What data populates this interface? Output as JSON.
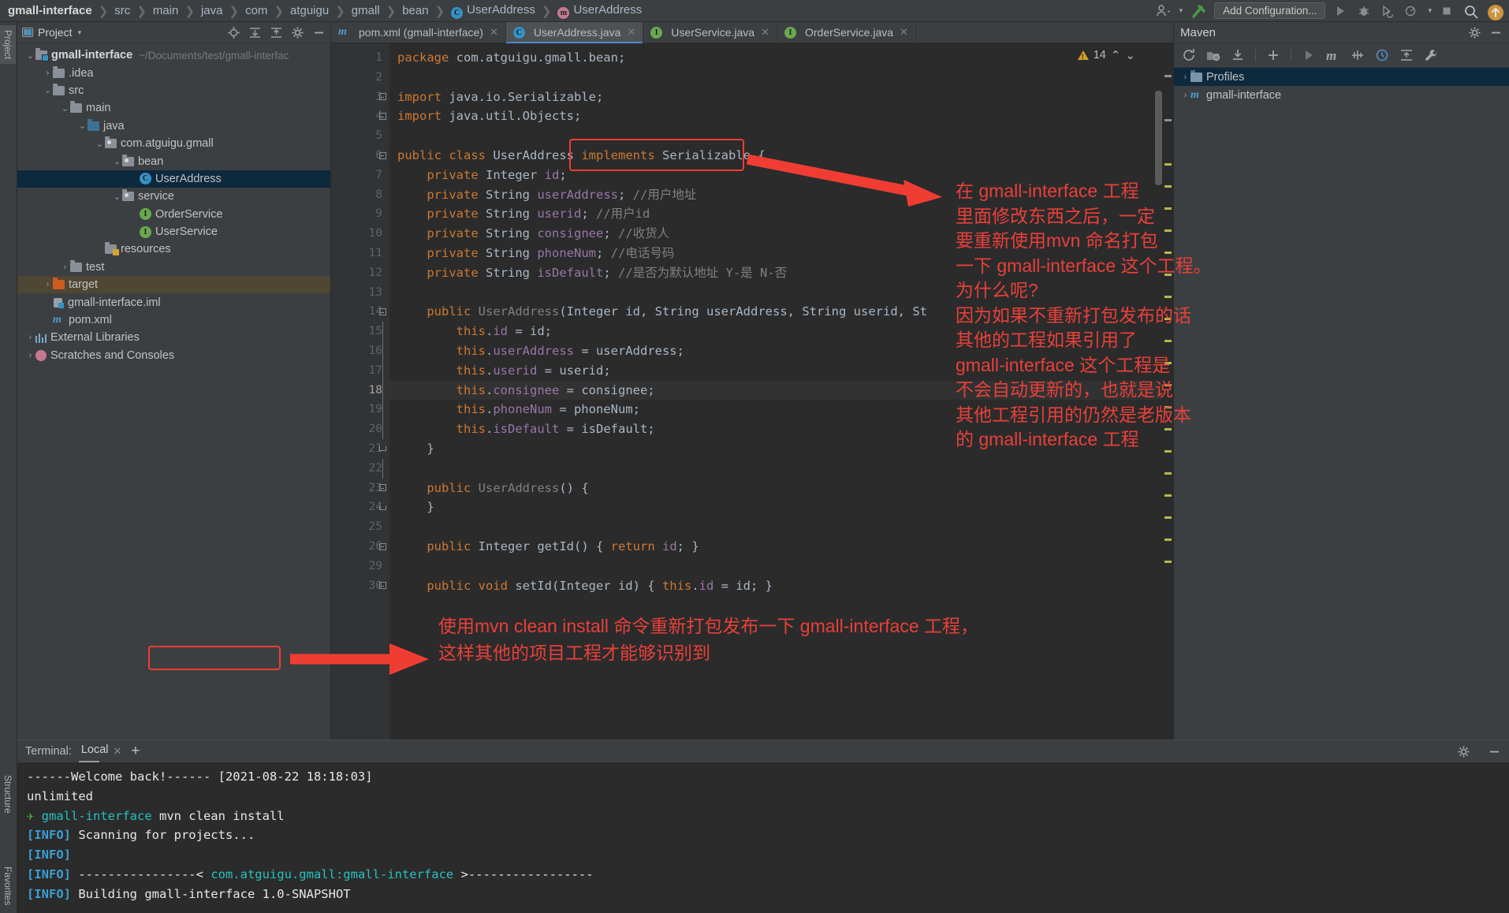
{
  "breadcrumb": [
    {
      "label": "gmall-interface",
      "bold": true,
      "icon": null
    },
    {
      "label": "src",
      "bold": false,
      "icon": null
    },
    {
      "label": "main",
      "bold": false,
      "icon": null
    },
    {
      "label": "java",
      "bold": false,
      "icon": null
    },
    {
      "label": "com",
      "bold": false,
      "icon": null
    },
    {
      "label": "atguigu",
      "bold": false,
      "icon": null
    },
    {
      "label": "gmall",
      "bold": false,
      "icon": null
    },
    {
      "label": "bean",
      "bold": false,
      "icon": null
    },
    {
      "label": "UserAddress",
      "bold": false,
      "icon": "class-icon"
    },
    {
      "label": "UserAddress",
      "bold": false,
      "icon": "method-icon"
    }
  ],
  "toolbar": {
    "add_configuration": "Add Configuration...",
    "icons": [
      "user-settings-icon",
      "build-hammer-icon",
      "run-icon",
      "debug-icon",
      "run-with-coverage-icon",
      "profile-icon",
      "stop-icon",
      "search-icon",
      "update-icon"
    ]
  },
  "left_strip": {
    "project_tab": "Project",
    "structure_tab": "Structure",
    "favorites_tab": "Favorites"
  },
  "project_panel": {
    "title": "Project",
    "toolbar_icons": [
      "locate-icon",
      "expand-all-icon",
      "collapse-all-icon",
      "settings-gear-icon",
      "hide-icon"
    ],
    "tree": [
      {
        "depth": 0,
        "label": "gmall-interface",
        "path": "~/Documents/test/gmall-interfac",
        "icon": "module-folder",
        "arrow": "down",
        "bold": true
      },
      {
        "depth": 1,
        "label": ".idea",
        "icon": "folder",
        "arrow": "right"
      },
      {
        "depth": 1,
        "label": "src",
        "icon": "folder",
        "arrow": "down"
      },
      {
        "depth": 2,
        "label": "main",
        "icon": "folder",
        "arrow": "down"
      },
      {
        "depth": 3,
        "label": "java",
        "icon": "source-folder",
        "arrow": "down"
      },
      {
        "depth": 4,
        "label": "com.atguigu.gmall",
        "icon": "package-folder",
        "arrow": "down"
      },
      {
        "depth": 5,
        "label": "bean",
        "icon": "package-folder",
        "arrow": "down"
      },
      {
        "depth": 6,
        "label": "UserAddress",
        "icon": "class-icon",
        "arrow": "none",
        "selected": true
      },
      {
        "depth": 5,
        "label": "service",
        "icon": "package-folder",
        "arrow": "down"
      },
      {
        "depth": 6,
        "label": "OrderService",
        "icon": "interface-icon",
        "arrow": "none"
      },
      {
        "depth": 6,
        "label": "UserService",
        "icon": "interface-icon",
        "arrow": "none"
      },
      {
        "depth": 4,
        "label": "resources",
        "icon": "resource-folder",
        "arrow": "none"
      },
      {
        "depth": 2,
        "label": "test",
        "icon": "folder",
        "arrow": "right"
      },
      {
        "depth": 1,
        "label": "target",
        "icon": "target-folder",
        "arrow": "right",
        "highlight": true
      },
      {
        "depth": 1,
        "label": "gmall-interface.iml",
        "icon": "iml-icon",
        "arrow": "none"
      },
      {
        "depth": 1,
        "label": "pom.xml",
        "icon": "maven-icon",
        "arrow": "none"
      },
      {
        "depth": 0,
        "label": "External Libraries",
        "icon": "library-icon",
        "arrow": "right"
      },
      {
        "depth": 0,
        "label": "Scratches and Consoles",
        "icon": "scratches-icon",
        "arrow": "right"
      }
    ]
  },
  "editor": {
    "tabs": [
      {
        "label": "pom.xml (gmall-interface)",
        "icon": "maven-icon",
        "active": false,
        "closable": true
      },
      {
        "label": "UserAddress.java",
        "icon": "class-icon",
        "active": true,
        "closable": true
      },
      {
        "label": "UserService.java",
        "icon": "interface-icon",
        "active": false,
        "closable": true
      },
      {
        "label": "OrderService.java",
        "icon": "interface-icon",
        "active": false,
        "closable": true
      }
    ],
    "warning_count": "14",
    "line_numbers": [
      "1",
      "2",
      "3",
      "4",
      "5",
      "6",
      "7",
      "8",
      "9",
      "10",
      "11",
      "12",
      "13",
      "14",
      "15",
      "16",
      "17",
      "18",
      "19",
      "20",
      "21",
      "22",
      "23",
      "24",
      "25",
      "26",
      "29",
      "30"
    ],
    "current_line": "18",
    "code_lines": [
      {
        "n": "1",
        "html": "<span class='kw'>package</span> com.atguigu.gmall.bean;"
      },
      {
        "n": "2",
        "html": ""
      },
      {
        "n": "3",
        "html": "<span class='kw'>import</span> java.io.Serializable;"
      },
      {
        "n": "4",
        "html": "<span class='kw'>import</span> java.util.Objects;"
      },
      {
        "n": "5",
        "html": ""
      },
      {
        "n": "6",
        "html": "<span class='kw'>public class</span> <span class='cls'>UserAddress</span> <span class='kw'>implements</span> <span class='cls'>Serializable</span> {"
      },
      {
        "n": "7",
        "html": "    <span class='kw'>private</span> <span class='cls'>Integer</span> <span class='fld'>id</span>;"
      },
      {
        "n": "8",
        "html": "    <span class='kw'>private</span> <span class='cls'>String</span> <span class='fld'>userAddress</span>; <span class='cmt'>//用户地址</span>"
      },
      {
        "n": "9",
        "html": "    <span class='kw'>private</span> <span class='cls'>String</span> <span class='fld'>userid</span>; <span class='cmt'>//用户id</span>"
      },
      {
        "n": "10",
        "html": "    <span class='kw'>private</span> <span class='cls'>String</span> <span class='fld'>consignee</span>; <span class='cmt'>//收货人</span>"
      },
      {
        "n": "11",
        "html": "    <span class='kw'>private</span> <span class='cls'>String</span> <span class='fld'>phoneNum</span>; <span class='cmt'>//电话号码</span>"
      },
      {
        "n": "12",
        "html": "    <span class='kw'>private</span> <span class='cls'>String</span> <span class='fld'>isDefault</span>; <span class='cmt'>//是否为默认地址 Y-是 N-否</span>"
      },
      {
        "n": "13",
        "html": ""
      },
      {
        "n": "14",
        "html": "    <span class='kw'>public</span> <span class='cmt'>UserAddress</span>(<span class='cls'>Integer</span> id, <span class='cls'>String</span> userAddress, <span class='cls'>String</span> userid, <span class='cls'>St</span>"
      },
      {
        "n": "15",
        "html": "        <span class='kw'>this</span>.<span class='fld'>id</span> = id;"
      },
      {
        "n": "16",
        "html": "        <span class='kw'>this</span>.<span class='fld'>userAddress</span> = userAddress;"
      },
      {
        "n": "17",
        "html": "        <span class='kw'>this</span>.<span class='fld'>userid</span> = userid;"
      },
      {
        "n": "18",
        "html": "        <span class='kw'>this</span>.<span class='fld'>consignee</span> = consignee;",
        "highlight": true
      },
      {
        "n": "19",
        "html": "        <span class='kw'>this</span>.<span class='fld'>phoneNum</span> = phoneNum;"
      },
      {
        "n": "20",
        "html": "        <span class='kw'>this</span>.<span class='fld'>isDefault</span> = isDefault;"
      },
      {
        "n": "21",
        "html": "    }"
      },
      {
        "n": "22",
        "html": ""
      },
      {
        "n": "23",
        "html": "    <span class='kw'>public</span> <span class='cmt'>UserAddress</span>() {"
      },
      {
        "n": "24",
        "html": "    }"
      },
      {
        "n": "25",
        "html": ""
      },
      {
        "n": "26",
        "html": "    <span class='kw'>public</span> <span class='cls'>Integer</span> getId() { <span class='kw'>return</span> <span class='fld'>id</span>; }"
      },
      {
        "n": "29",
        "html": ""
      },
      {
        "n": "30",
        "html": "    <span class='kw'>public void</span> setId(<span class='cls'>Integer</span> id) { <span class='kw'>this</span>.<span class='fld'>id</span> = id; }"
      }
    ]
  },
  "maven_panel": {
    "title": "Maven",
    "toolbar_icons": [
      "reload-icon",
      "generate-sources-icon",
      "download-sources-icon",
      "add-icon",
      "run-icon",
      "maven-m-icon",
      "skip-tests-icon",
      "execute-goal-icon",
      "collapse-all-icon",
      "settings-wrench-icon"
    ],
    "items": [
      {
        "label": "Profiles",
        "icon": "profiles-icon",
        "arrow": "right",
        "selected": true
      },
      {
        "label": "gmall-interface",
        "icon": "maven-module-icon",
        "arrow": "right",
        "selected": false
      }
    ]
  },
  "terminal": {
    "label": "Terminal:",
    "tab": "Local",
    "add_label": "+",
    "lines": [
      {
        "segments": [
          {
            "t": "------Welcome back!------ [2021-08-22 18:18:03]",
            "c": "ti-w"
          }
        ]
      },
      {
        "segments": [
          {
            "t": "unlimited",
            "c": "ti-w"
          }
        ]
      },
      {
        "segments": [
          {
            "t": "✈ ",
            "c": "ti-green"
          },
          {
            "t": "gmall-interface ",
            "c": "ti-cyan"
          },
          {
            "t": "mvn clean install",
            "c": "ti-w"
          }
        ]
      },
      {
        "segments": [
          {
            "t": "[INFO]",
            "c": "ti-info"
          },
          {
            "t": " Scanning for projects...",
            "c": "ti-w"
          }
        ]
      },
      {
        "segments": [
          {
            "t": "[INFO]",
            "c": "ti-info"
          }
        ]
      },
      {
        "segments": [
          {
            "t": "[INFO]",
            "c": "ti-info"
          },
          {
            "t": " ----------------< ",
            "c": "ti-w"
          },
          {
            "t": "com.atguigu.gmall:gmall-interface",
            "c": "ti-cyan"
          },
          {
            "t": " >-----------------",
            "c": "ti-w"
          }
        ]
      },
      {
        "segments": [
          {
            "t": "[INFO]",
            "c": "ti-info"
          },
          {
            "t": " Building gmall-interface 1.0-SNAPSHOT",
            "c": "ti-w"
          }
        ]
      }
    ]
  },
  "annotations": {
    "right_note": "在 gmall-interface 工程\n里面修改东西之后，一定\n要重新使用mvn 命名打包\n一下 gmall-interface 这个工程。\n为什么呢?\n因为如果不重新打包发布的话\n其他的工程如果引用了\ngmall-interface 这个工程是\n不会自动更新的，也就是说\n其他工程引用的仍然是老版本\n的 gmall-interface 工程",
    "bottom_note": "使用mvn clean install 命令重新打包发布一下 gmall-interface 工程，\n这样其他的项目工程才能够识别到",
    "color": "#e8403a"
  }
}
